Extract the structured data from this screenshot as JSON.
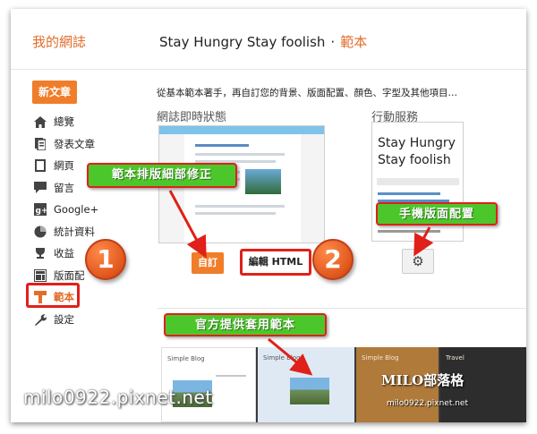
{
  "header": {
    "brand": "我的網誌",
    "blog_title": "Stay Hungry Stay foolish",
    "separator": "·",
    "section": "範本"
  },
  "sidebar": {
    "new_post": "新文章",
    "items": [
      {
        "label": "總覽",
        "icon": "home-icon"
      },
      {
        "label": "發表文章",
        "icon": "posts-icon"
      },
      {
        "label": "網頁",
        "icon": "pages-icon"
      },
      {
        "label": "留言",
        "icon": "comment-icon"
      },
      {
        "label": "Google+",
        "icon": "google-plus-icon"
      },
      {
        "label": "統計資料",
        "icon": "stats-icon"
      },
      {
        "label": "收益",
        "icon": "earnings-icon"
      },
      {
        "label": "版面配",
        "icon": "layout-icon"
      },
      {
        "label": "範本",
        "icon": "template-icon"
      },
      {
        "label": "設定",
        "icon": "wrench-icon"
      }
    ],
    "active_index": 8
  },
  "main": {
    "intro": "從基本範本著手，再自訂您的背景、版面配置、顏色、字型及其他項目…",
    "live_label": "網誌即時狀態",
    "mobile_label": "行動服務",
    "mobile_preview_title": "Stay Hungry Stay foolish",
    "customize_button": "自訂",
    "edit_html_button": "編輯 HTML"
  },
  "templates": [
    {
      "label": "Simple Blog"
    },
    {
      "label": "Simple Blog"
    },
    {
      "label": "Simple Blog"
    },
    {
      "label": "Travel"
    }
  ],
  "annotations": {
    "callout_1": "範本排版細部修正",
    "callout_2": "手機版面配置",
    "callout_3": "官方提供套用範本",
    "number_1": "1",
    "number_2": "2"
  },
  "watermark": {
    "text": "milo0922.pixnet.net",
    "logo_text": "MILO部落格",
    "logo_sub": "milo0922.pixnet.net"
  },
  "colors": {
    "accent_orange": "#e36c29",
    "button_orange": "#f07d2a",
    "callout_green": "#4cc72b",
    "highlight_red": "#e0201a"
  }
}
